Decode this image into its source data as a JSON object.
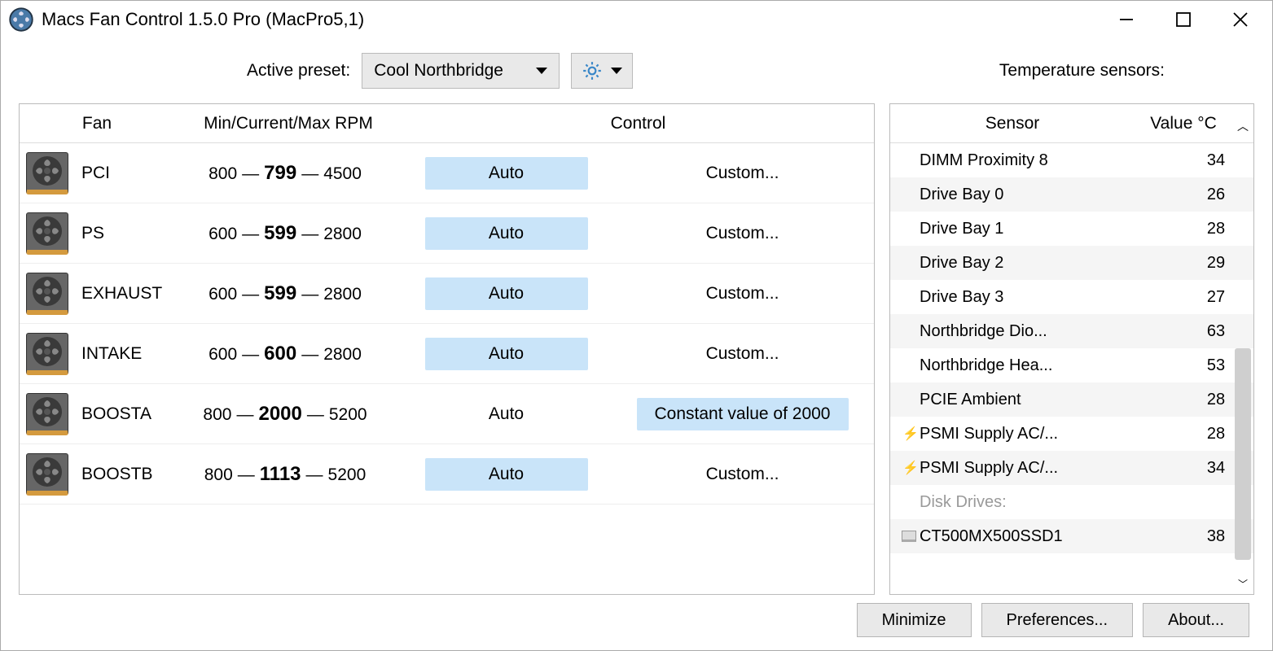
{
  "window": {
    "title": "Macs Fan Control 1.5.0 Pro (MacPro5,1)"
  },
  "toolbar": {
    "preset_label": "Active preset:",
    "preset_value": "Cool Northbridge",
    "sensors_title": "Temperature sensors:"
  },
  "fan_table": {
    "head_fan": "Fan",
    "head_rpm": "Min/Current/Max RPM",
    "head_control": "Control",
    "rows": [
      {
        "name": "PCI",
        "min": "800",
        "cur": "799",
        "max": "4500",
        "auto_active": true,
        "custom_label": "Custom..."
      },
      {
        "name": "PS",
        "min": "600",
        "cur": "599",
        "max": "2800",
        "auto_active": true,
        "custom_label": "Custom..."
      },
      {
        "name": "EXHAUST",
        "min": "600",
        "cur": "599",
        "max": "2800",
        "auto_active": true,
        "custom_label": "Custom..."
      },
      {
        "name": "INTAKE",
        "min": "600",
        "cur": "600",
        "max": "2800",
        "auto_active": true,
        "custom_label": "Custom..."
      },
      {
        "name": "BOOSTA",
        "min": "800",
        "cur": "2000",
        "max": "5200",
        "auto_active": false,
        "custom_label": "Constant value of 2000"
      },
      {
        "name": "BOOSTB",
        "min": "800",
        "cur": "1113",
        "max": "5200",
        "auto_active": true,
        "custom_label": "Custom..."
      }
    ],
    "auto_label": "Auto"
  },
  "sensor_table": {
    "head_sensor": "Sensor",
    "head_value": "Value °C",
    "rows": [
      {
        "name": "DIMM Proximity 8",
        "value": "34",
        "spark": false
      },
      {
        "name": "Drive Bay 0",
        "value": "26",
        "spark": false
      },
      {
        "name": "Drive Bay 1",
        "value": "28",
        "spark": false
      },
      {
        "name": "Drive Bay 2",
        "value": "29",
        "spark": false
      },
      {
        "name": "Drive Bay 3",
        "value": "27",
        "spark": false
      },
      {
        "name": "Northbridge Dio...",
        "value": "63",
        "spark": false
      },
      {
        "name": "Northbridge Hea...",
        "value": "53",
        "spark": false
      },
      {
        "name": "PCIE Ambient",
        "value": "28",
        "spark": false
      },
      {
        "name": "PSMI Supply AC/...",
        "value": "28",
        "spark": true
      },
      {
        "name": "PSMI Supply AC/...",
        "value": "34",
        "spark": true
      }
    ],
    "group_label": "Disk Drives:",
    "drive_row": {
      "name": "CT500MX500SSD1",
      "value": "38"
    }
  },
  "footer": {
    "minimize": "Minimize",
    "preferences": "Preferences...",
    "about": "About..."
  }
}
